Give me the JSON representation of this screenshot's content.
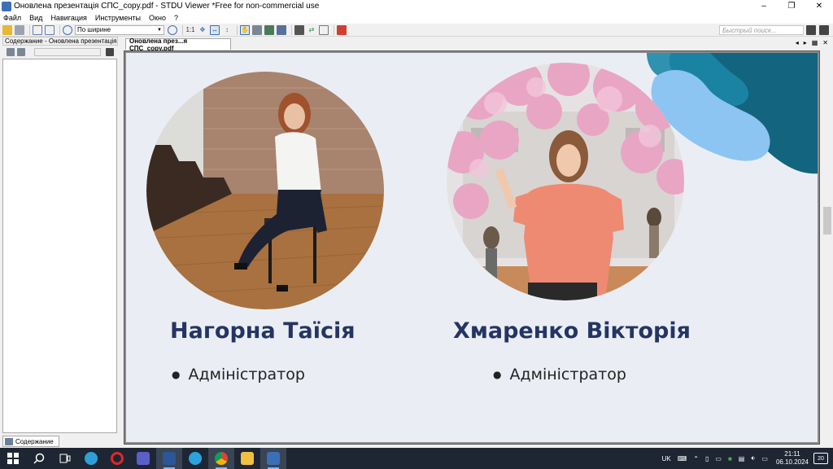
{
  "window": {
    "title": "Оновлена презентація СПС_copy.pdf - STDU Viewer *Free for non-commercial use",
    "minimize": "–",
    "restore": "❐",
    "close": "✕"
  },
  "menu": [
    "Файл",
    "Вид",
    "Навигация",
    "Инструменты",
    "Окно",
    "?"
  ],
  "toolbar": {
    "zoom_label": "1:1",
    "zoom_mode": "По ширине",
    "search_placeholder": "Быстрый поиск..."
  },
  "left_panel": {
    "header": "Содержание - Оновлена презентація",
    "tab_label": "Содержание"
  },
  "doc_tab": {
    "label": "Оновлена през...я СПС_copy.pdf"
  },
  "slide": {
    "people": [
      {
        "name": "Нагорна Таїсія",
        "role": "Адміністратор"
      },
      {
        "name": "Хмаренко Вікторія",
        "role": "Адміністратор"
      }
    ],
    "colors": {
      "background": "#eaeef4",
      "name": "#253563",
      "blob_dark": "#13647f",
      "blob_light": "#8cc5f2"
    }
  },
  "taskbar": {
    "lang": "UK",
    "time": "21:11",
    "date": "06.10.2024",
    "notifications": "20"
  }
}
